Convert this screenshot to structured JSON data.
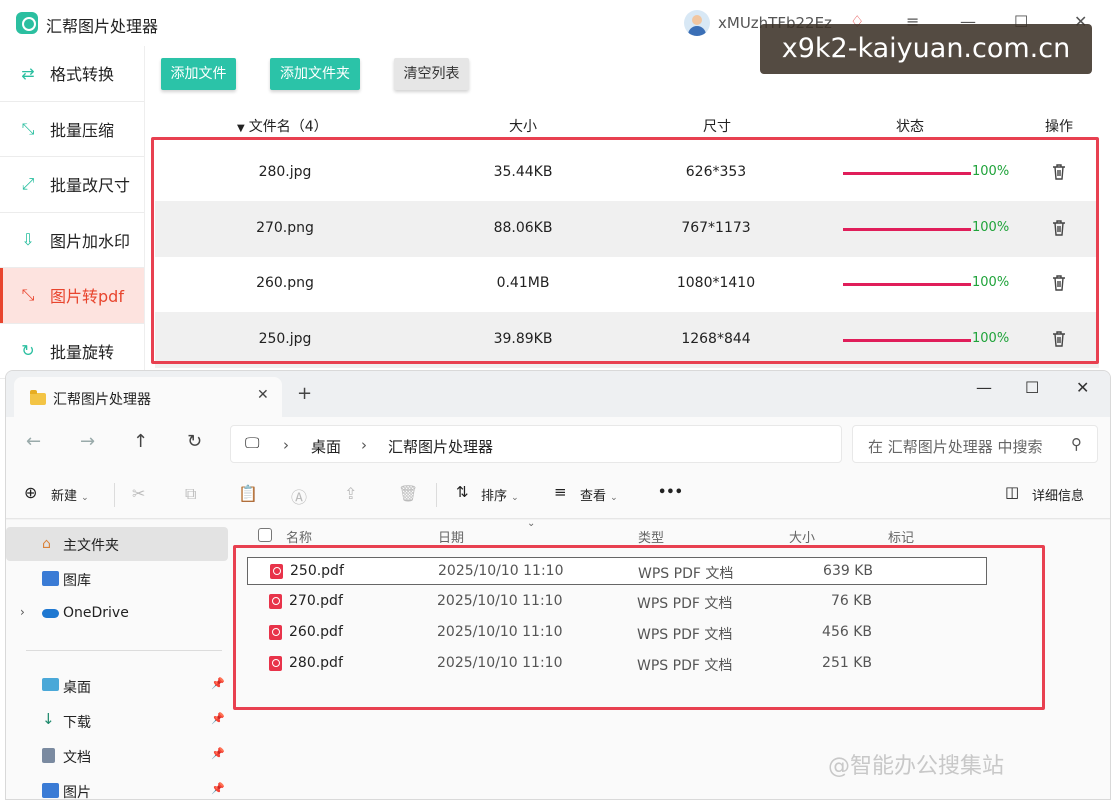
{
  "app": {
    "title": "汇帮图片处理器",
    "user": "xMUzhTFb22Ez",
    "minimize": "—",
    "maximize": "☐",
    "close": "✕",
    "sidebar": [
      {
        "label": "格式转换",
        "icon": "format-icon",
        "glyph": "⇄",
        "active": false
      },
      {
        "label": "批量压缩",
        "icon": "compress-icon",
        "glyph": "⤡",
        "active": false
      },
      {
        "label": "批量改尺寸",
        "icon": "resize-icon",
        "glyph": "⤢",
        "active": false
      },
      {
        "label": "图片加水印",
        "icon": "watermark-icon",
        "glyph": "⇩",
        "active": false
      },
      {
        "label": "图片转pdf",
        "icon": "pdf-convert-icon",
        "glyph": "⤡",
        "active": true
      },
      {
        "label": "批量旋转",
        "icon": "rotate-icon",
        "glyph": "↻",
        "active": false
      }
    ],
    "toolbar": {
      "add_file": "添加文件",
      "add_folder": "添加文件夹",
      "clear_list": "清空列表"
    },
    "table": {
      "headers": {
        "name": "文件名（4）",
        "size": "大小",
        "dimensions": "尺寸",
        "status": "状态",
        "action": "操作"
      },
      "rows": [
        {
          "name": "280.jpg",
          "size": "35.44KB",
          "dimensions": "626*353",
          "progress": 1.0,
          "percent": "100%"
        },
        {
          "name": "270.png",
          "size": "88.06KB",
          "dimensions": "767*1173",
          "progress": 1.0,
          "percent": "100%"
        },
        {
          "name": "260.png",
          "size": "0.41MB",
          "dimensions": "1080*1410",
          "progress": 1.0,
          "percent": "100%"
        },
        {
          "name": "250.jpg",
          "size": "39.89KB",
          "dimensions": "1268*844",
          "progress": 1.0,
          "percent": "100%"
        }
      ]
    }
  },
  "watermark": "x9k2-kaiyuan.com.cn",
  "explorer": {
    "tab_title": "汇帮图片处理器",
    "tab_close": "✕",
    "new_tab": "+",
    "breadcrumb": [
      "桌面",
      "汇帮图片处理器"
    ],
    "breadcrumb_sep": "›",
    "search_placeholder": "在 汇帮图片处理器 中搜索",
    "commands": {
      "new": "新建",
      "sort": "排序",
      "view": "查看",
      "more": "•••",
      "details": "详细信息"
    },
    "nav_pane": [
      {
        "label": "主文件夹",
        "icon": "home-icon"
      },
      {
        "label": "图库",
        "icon": "gallery-icon"
      },
      {
        "label": "OneDrive",
        "icon": "onedrive-icon"
      },
      {
        "label": "桌面",
        "icon": "desktop-icon"
      },
      {
        "label": "下载",
        "icon": "download-icon"
      },
      {
        "label": "文档",
        "icon": "document-icon"
      },
      {
        "label": "图片",
        "icon": "pictures-icon"
      }
    ],
    "columns": {
      "name": "名称",
      "date": "日期",
      "type": "类型",
      "size": "大小",
      "tags": "标记"
    },
    "files": [
      {
        "name": "250.pdf",
        "date": "2025/10/10 11:10",
        "type": "WPS PDF 文档",
        "size": "639 KB"
      },
      {
        "name": "270.pdf",
        "date": "2025/10/10 11:10",
        "type": "WPS PDF 文档",
        "size": "76 KB"
      },
      {
        "name": "260.pdf",
        "date": "2025/10/10 11:10",
        "type": "WPS PDF 文档",
        "size": "456 KB"
      },
      {
        "name": "280.pdf",
        "date": "2025/10/10 11:10",
        "type": "WPS PDF 文档",
        "size": "251 KB"
      }
    ]
  },
  "footer_mark": "@智能办公搜集站",
  "colors": {
    "accent": "#2bc3a8",
    "active": "#e8452e",
    "progress": "#e01e5a",
    "percent": "#1fa33a",
    "highlight": "#e84050"
  }
}
